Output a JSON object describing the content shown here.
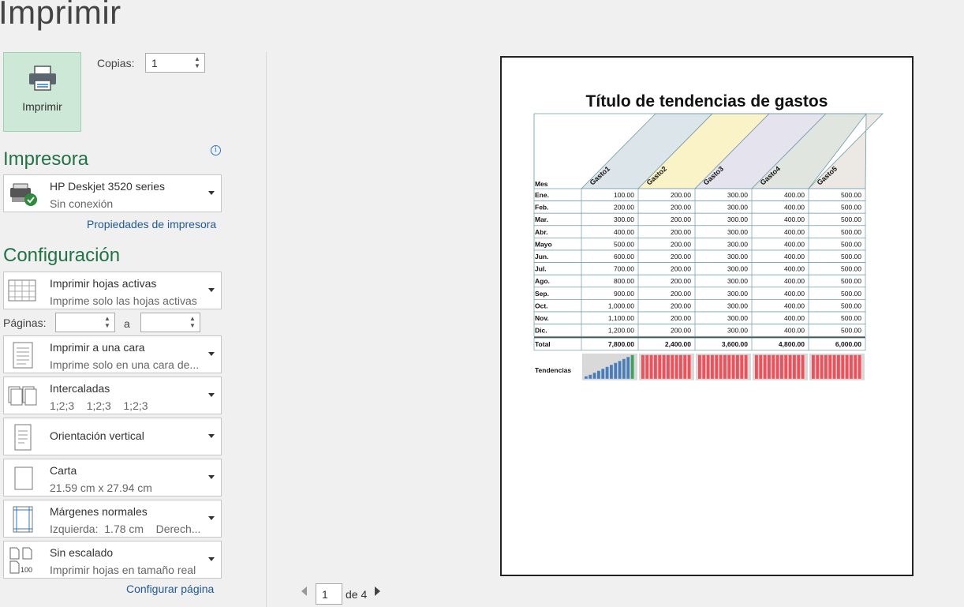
{
  "page": {
    "title": "Imprimir"
  },
  "print_button": {
    "label": "Imprimir"
  },
  "copies": {
    "label": "Copias:",
    "value": "1"
  },
  "printer": {
    "heading": "Impresora",
    "name": "HP Deskjet 3520 series",
    "status": "Sin conexión",
    "properties_link": "Propiedades de impresora"
  },
  "settings": {
    "heading": "Configuración",
    "what": {
      "title": "Imprimir hojas activas",
      "desc": "Imprime solo las hojas activas"
    },
    "pages": {
      "label": "Páginas:",
      "to": "a",
      "from_value": "",
      "to_value": ""
    },
    "sides": {
      "title": "Imprimir a una cara",
      "desc": "Imprime solo en una cara de..."
    },
    "collate": {
      "title": "Intercaladas",
      "desc": "1;2;3    1;2;3    1;2;3"
    },
    "orientation": {
      "title": "Orientación vertical"
    },
    "paper": {
      "title": "Carta",
      "desc": "21.59 cm x 27.94 cm"
    },
    "margins": {
      "title": "Márgenes normales",
      "desc": "Izquierda:  1.78 cm    Derech..."
    },
    "scaling": {
      "title": "Sin escalado",
      "desc": "Imprimir hojas en tamaño real",
      "icon_text": "100"
    },
    "page_setup_link": "Configurar página"
  },
  "navigation": {
    "current": "1",
    "of": "de 4"
  },
  "preview": {
    "title": "Título de tendencias de gastos",
    "header_month": "Mes",
    "columns": [
      "Gasto1",
      "Gasto2",
      "Gasto3",
      "Gasto4",
      "Gasto5"
    ],
    "column_colors": [
      "#dce6ea",
      "#fbf3c8",
      "#e5e3ee",
      "#e0e6df",
      "#ece9e4"
    ],
    "rows": [
      {
        "month": "Ene.",
        "values": [
          "100.00",
          "200.00",
          "300.00",
          "400.00",
          "500.00"
        ]
      },
      {
        "month": "Feb.",
        "values": [
          "200.00",
          "200.00",
          "300.00",
          "400.00",
          "500.00"
        ]
      },
      {
        "month": "Mar.",
        "values": [
          "300.00",
          "200.00",
          "300.00",
          "400.00",
          "500.00"
        ]
      },
      {
        "month": "Abr.",
        "values": [
          "400.00",
          "200.00",
          "300.00",
          "400.00",
          "500.00"
        ]
      },
      {
        "month": "Mayo",
        "values": [
          "500.00",
          "200.00",
          "300.00",
          "400.00",
          "500.00"
        ]
      },
      {
        "month": "Jun.",
        "values": [
          "600.00",
          "200.00",
          "300.00",
          "400.00",
          "500.00"
        ]
      },
      {
        "month": "Jul.",
        "values": [
          "700.00",
          "200.00",
          "300.00",
          "400.00",
          "500.00"
        ]
      },
      {
        "month": "Ago.",
        "values": [
          "800.00",
          "200.00",
          "300.00",
          "400.00",
          "500.00"
        ]
      },
      {
        "month": "Sep.",
        "values": [
          "900.00",
          "200.00",
          "300.00",
          "400.00",
          "500.00"
        ]
      },
      {
        "month": "Oct.",
        "values": [
          "1,000.00",
          "200.00",
          "300.00",
          "400.00",
          "500.00"
        ]
      },
      {
        "month": "Nov.",
        "values": [
          "1,100.00",
          "200.00",
          "300.00",
          "400.00",
          "500.00"
        ]
      },
      {
        "month": "Dic.",
        "values": [
          "1,200.00",
          "200.00",
          "300.00",
          "400.00",
          "500.00"
        ]
      }
    ],
    "total": {
      "label": "Total",
      "values": [
        "7,800.00",
        "2,400.00",
        "3,600.00",
        "4,800.00",
        "6,000.00"
      ]
    },
    "trends_label": "Tendencias",
    "sparklines": [
      [
        100,
        200,
        300,
        400,
        500,
        600,
        700,
        800,
        900,
        1000,
        1100,
        1200
      ],
      [
        200,
        200,
        200,
        200,
        200,
        200,
        200,
        200,
        200,
        200,
        200,
        200
      ],
      [
        300,
        300,
        300,
        300,
        300,
        300,
        300,
        300,
        300,
        300,
        300,
        300
      ],
      [
        400,
        400,
        400,
        400,
        400,
        400,
        400,
        400,
        400,
        400,
        400,
        400
      ],
      [
        500,
        500,
        500,
        500,
        500,
        500,
        500,
        500,
        500,
        500,
        500,
        500
      ]
    ],
    "spark_colors": {
      "rising": "#4a7ebb",
      "last_high": "#3fa15a",
      "flat": "#f0505a"
    }
  },
  "colors": {
    "accent": "#217346",
    "link": "#1f5a96"
  }
}
